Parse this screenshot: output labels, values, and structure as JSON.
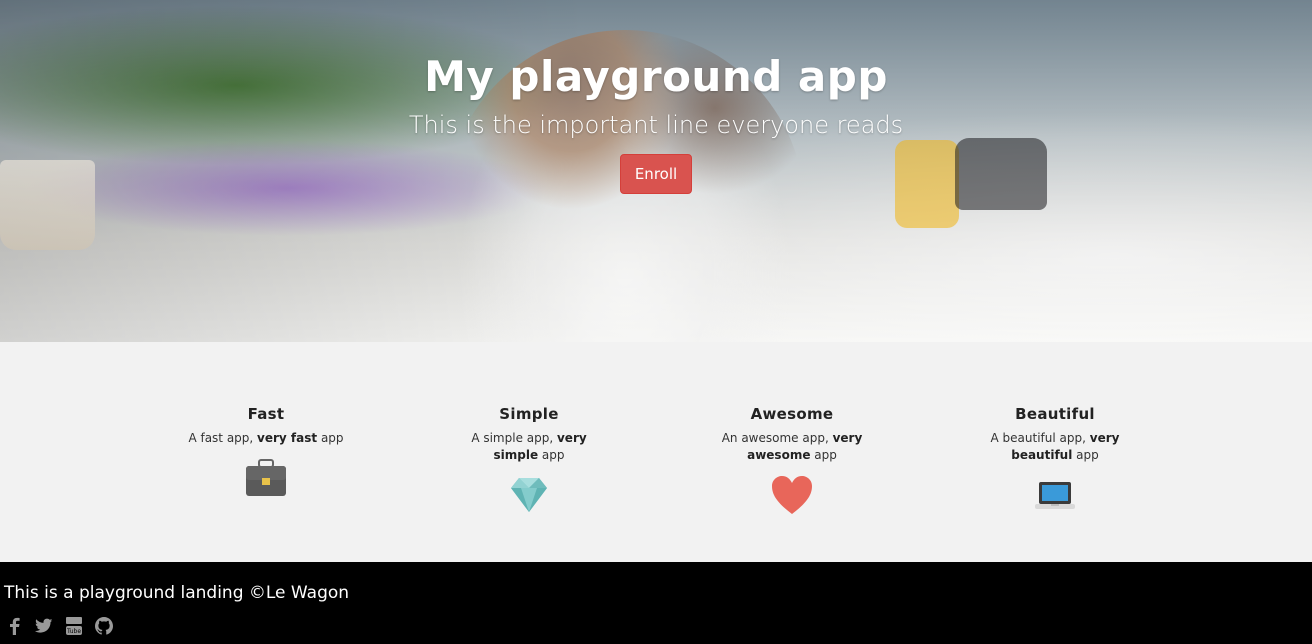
{
  "hero": {
    "title": "My playground app",
    "subtitle": "This is the important line everyone reads",
    "enroll_label": "Enroll",
    "colors": {
      "button": "#d9534f",
      "text": "#ffffff"
    }
  },
  "features": [
    {
      "title": "Fast",
      "desc_prefix": "A fast app, ",
      "desc_bold": "very fast",
      "desc_suffix": " app",
      "icon": "briefcase-icon"
    },
    {
      "title": "Simple",
      "desc_prefix": "A simple app, ",
      "desc_bold": "very simple",
      "desc_suffix": " app",
      "icon": "diamond-icon"
    },
    {
      "title": "Awesome",
      "desc_prefix": "An awesome app, ",
      "desc_bold": "very awesome",
      "desc_suffix": " app",
      "icon": "heart-icon"
    },
    {
      "title": "Beautiful",
      "desc_prefix": "A beautiful app, ",
      "desc_bold": "very beautiful",
      "desc_suffix": " app",
      "icon": "laptop-icon"
    }
  ],
  "footer": {
    "text": "This is a playground landing ©Le Wagon",
    "social": [
      {
        "name": "facebook-icon"
      },
      {
        "name": "twitter-icon"
      },
      {
        "name": "youtube-icon"
      },
      {
        "name": "github-icon"
      }
    ],
    "colors": {
      "background": "#000000",
      "icon": "#9a9a9a"
    }
  },
  "features_background": "#f2f2f2"
}
